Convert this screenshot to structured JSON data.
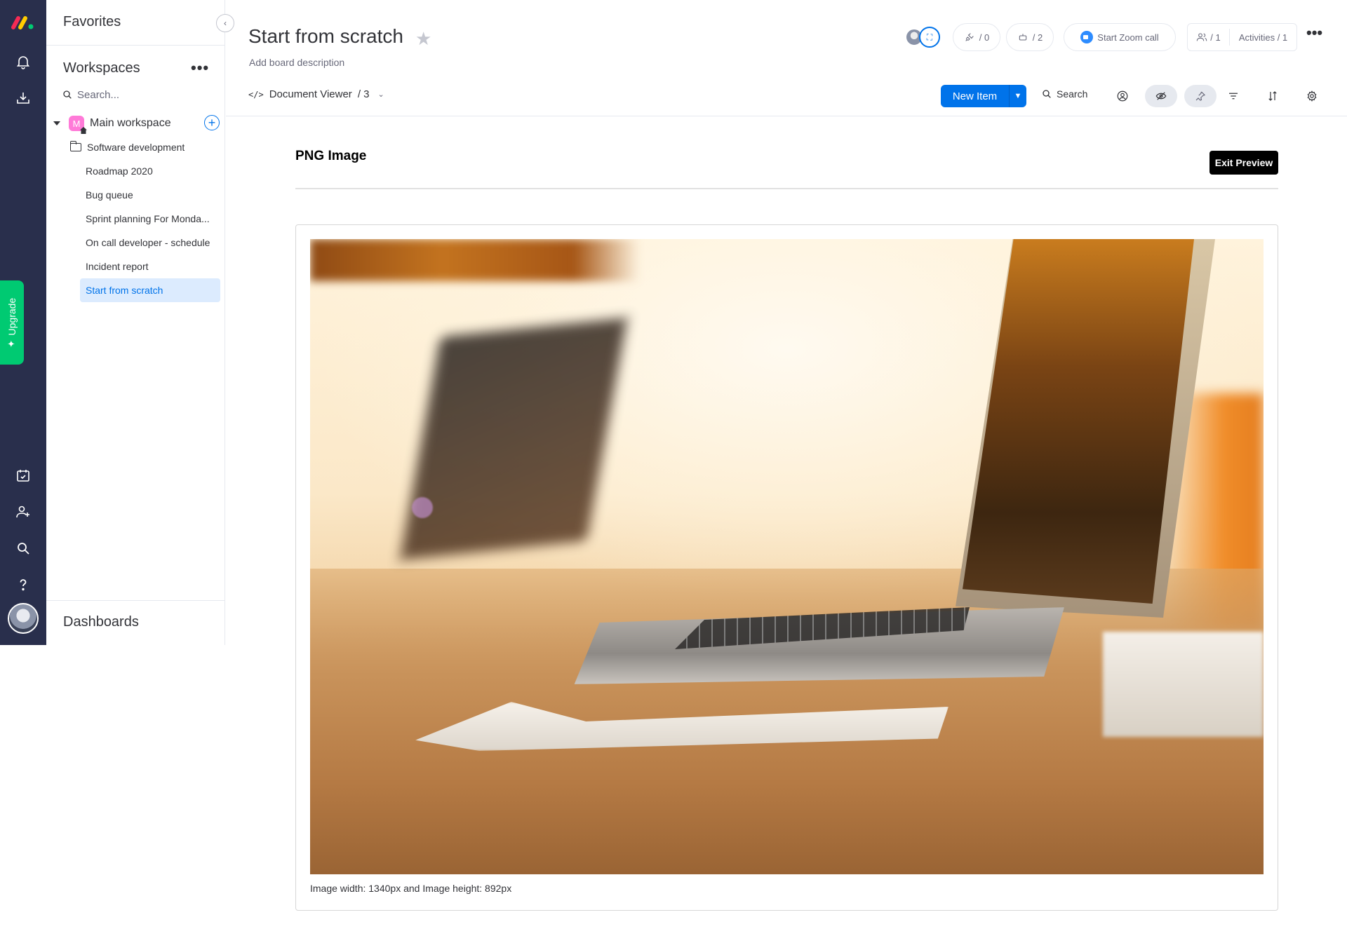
{
  "rail": {
    "upgrade_label": "Upgrade",
    "icons": [
      "monday-logo",
      "bell-icon",
      "inbox-icon",
      "my-work-icon",
      "invite-members-icon",
      "search-icon",
      "help-icon",
      "avatar"
    ]
  },
  "panel": {
    "favorites_title": "Favorites",
    "workspaces_title": "Workspaces",
    "workspaces_more": "•••",
    "search_placeholder": "Search...",
    "workspace": {
      "badge": "M",
      "name": "Main workspace"
    },
    "folder": "Software development",
    "boards": [
      "Roadmap 2020",
      "Bug queue",
      "Sprint planning For Monda...",
      "On call developer - schedule",
      "Incident report",
      "Start from scratch"
    ],
    "dashboards_title": "Dashboards"
  },
  "header": {
    "title": "Start from scratch",
    "description": "Add board description",
    "integrations_count": "/ 0",
    "automations_count": "/ 2",
    "zoom_label": "Start Zoom call",
    "members_count": "/ 1",
    "activities_label": "Activities / 1",
    "more": "•••"
  },
  "toolbar": {
    "view_label": "Document Viewer",
    "view_count": "/ 3",
    "new_item_label": "New Item",
    "search_label": "Search"
  },
  "preview": {
    "title": "PNG Image",
    "exit_label": "Exit Preview",
    "caption": "Image width: 1340px and Image height: 892px"
  },
  "colors": {
    "rail_bg": "#292f4c",
    "accent": "#0073ea",
    "upgrade": "#00ca72",
    "active_item_bg": "#dcebfe"
  }
}
